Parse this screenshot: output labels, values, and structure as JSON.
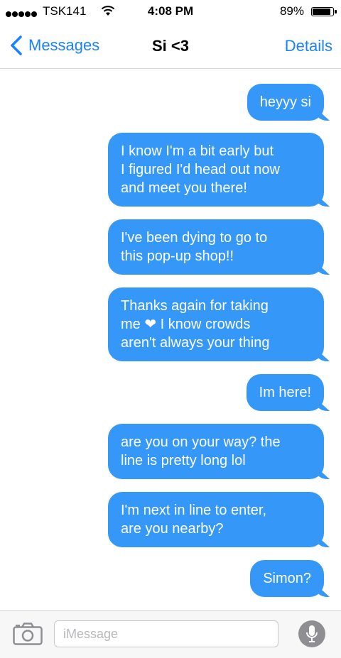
{
  "status_bar": {
    "carrier": "TSK141",
    "time": "4:08 PM",
    "battery": "89%",
    "battery_level": 0.89
  },
  "nav": {
    "back_label": "Messages",
    "title": "Si <3",
    "details_label": "Details"
  },
  "messages": [
    {
      "text": "heyyy si"
    },
    {
      "text": "I know I'm a bit early but\nI figured I'd head out now\nand meet you there!"
    },
    {
      "text": "I've been dying to go to\nthis pop-up shop!!"
    },
    {
      "text": "Thanks again for taking\nme ❤ I know crowds\naren't always your thing"
    },
    {
      "text": "Im here!"
    },
    {
      "text": "are you on your way? the\nline is pretty long lol"
    },
    {
      "text": "I'm next in line to enter,\nare you nearby?"
    },
    {
      "text": "Simon?"
    }
  ],
  "input": {
    "placeholder": "iMessage"
  },
  "colors": {
    "accent": "#1a82fb",
    "bubble": "#3597f7"
  },
  "icons": [
    "chevron-left-icon",
    "wifi-icon",
    "battery-icon",
    "camera-icon",
    "microphone-icon"
  ]
}
